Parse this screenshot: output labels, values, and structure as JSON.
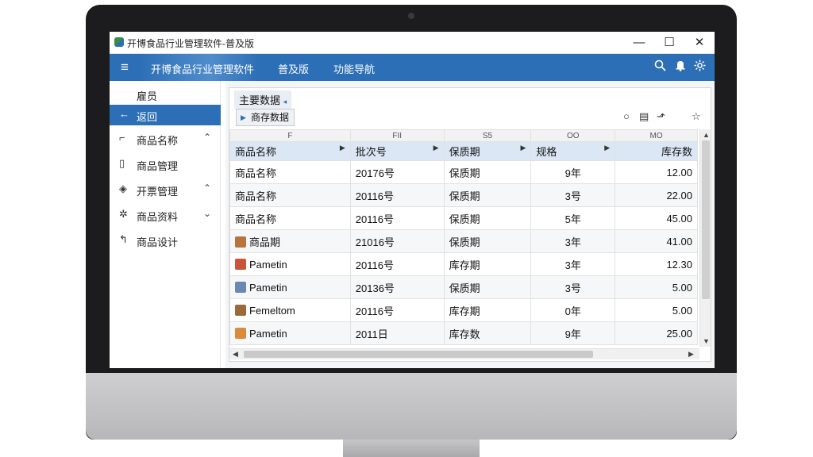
{
  "window": {
    "title": "开博食品行业管理软件-普及版",
    "minimize": "—",
    "maximize": "☐",
    "close": "✕"
  },
  "ribbon": {
    "menu_icon": "≡",
    "app_name": "开博食品行业管理软件",
    "tab1": "普及版",
    "tab2": "功能导航",
    "icons": [
      "search-icon",
      "bell-icon",
      "settings-icon"
    ]
  },
  "sidebar": {
    "items": [
      {
        "icon": "",
        "label": "雇员",
        "chevron": ""
      },
      {
        "icon": "←",
        "label": "返回",
        "chevron": ""
      },
      {
        "icon": "⌐",
        "label": "商品名称",
        "chevron": "⌃"
      },
      {
        "icon": "▯",
        "label": "商品管理",
        "chevron": ""
      },
      {
        "icon": "◈",
        "label": "开票管理",
        "chevron": "⌃"
      },
      {
        "icon": "✲",
        "label": "商品资料",
        "chevron": "⌄"
      },
      {
        "icon": "↰",
        "label": "商品设计",
        "chevron": ""
      }
    ]
  },
  "panel": {
    "title": "主要数据",
    "title_arrow": "◂",
    "subtab": "商存数据",
    "tools": [
      "○",
      "▤",
      "⬏",
      "☆"
    ]
  },
  "table": {
    "codes": [
      "",
      "F",
      "FII",
      "S5",
      "OO",
      "MO"
    ],
    "headers": [
      "商品名称",
      "批次号",
      "保质期",
      "规格",
      "库存数"
    ],
    "rows": [
      {
        "name": "商品名称",
        "batch": "20176号",
        "type": "保质期",
        "spec": "9年",
        "qty": "12.00",
        "thumb": ""
      },
      {
        "name": "商品名称",
        "batch": "20116号",
        "type": "保质期",
        "spec": "3号",
        "qty": "22.00",
        "thumb": ""
      },
      {
        "name": "商品名称",
        "batch": "20116号",
        "type": "保质期",
        "spec": "5年",
        "qty": "45.00",
        "thumb": ""
      },
      {
        "name": "商品期",
        "batch": "21016号",
        "type": "保质期",
        "spec": "3年",
        "qty": "41.00",
        "thumb": "#b9733e"
      },
      {
        "name": "Pametin",
        "batch": "20116号",
        "type": "库存期",
        "spec": "3年",
        "qty": "12.30",
        "thumb": "#c8553a"
      },
      {
        "name": "Pametin",
        "batch": "20136号",
        "type": "保质期",
        "spec": "3号",
        "qty": "5.00",
        "thumb": "#6b88b5"
      },
      {
        "name": "Femeltom",
        "batch": "20116号",
        "type": "库存期",
        "spec": "0年",
        "qty": "5.00",
        "thumb": "#9a6a3a"
      },
      {
        "name": "Pametin",
        "batch": "2011日",
        "type": "库存数",
        "spec": "9年",
        "qty": "25.00",
        "thumb": "#d98a3a"
      }
    ]
  }
}
